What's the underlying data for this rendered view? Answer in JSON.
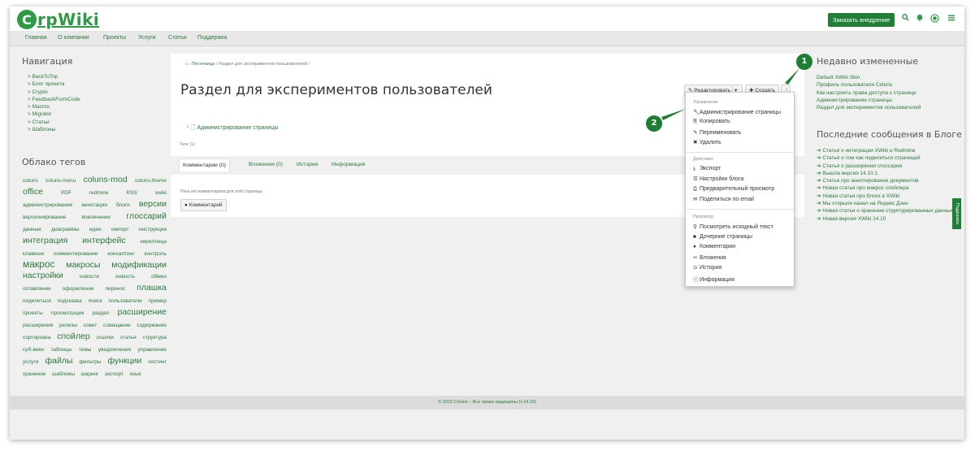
{
  "header": {
    "logo_mark": "C",
    "logo_text": "rpWiki",
    "order_button": "Заказать внедрение"
  },
  "mainnav": [
    "Главная",
    "О компании",
    "Проекты",
    "Услуги",
    "Статьи",
    "Поддержка"
  ],
  "left": {
    "nav_title": "Навигация",
    "nav_items": [
      "> BackToTop",
      "> Блог проекта",
      "> Crypto",
      "> FeedbackFormCode",
      "> Macros",
      "> Migrator",
      "> Статьи",
      "> Шаблоны"
    ],
    "tags_title": "Облако тегов",
    "tags": [
      {
        "t": "coluns",
        "s": 1
      },
      {
        "t": "coluns-menu",
        "s": 1
      },
      {
        "t": "coluns-mod",
        "s": 3
      },
      {
        "t": "coluns-theme",
        "s": 1
      },
      {
        "t": "office",
        "s": 3
      },
      {
        "t": "PDF",
        "s": 1
      },
      {
        "t": "redmine",
        "s": 1
      },
      {
        "t": "RSS",
        "s": 1
      },
      {
        "t": "xwiki",
        "s": 1
      },
      {
        "t": "администрирование",
        "s": 1
      },
      {
        "t": "аннотации",
        "s": 1
      },
      {
        "t": "блоги",
        "s": 1
      },
      {
        "t": "версии",
        "s": 3
      },
      {
        "t": "версионирование",
        "s": 1
      },
      {
        "t": "вовлечение",
        "s": 1
      },
      {
        "t": "глоссарий",
        "s": 3
      },
      {
        "t": "данные",
        "s": 1
      },
      {
        "t": "диаграммы",
        "s": 1
      },
      {
        "t": "идеи",
        "s": 1
      },
      {
        "t": "импорт",
        "s": 1
      },
      {
        "t": "инструкция",
        "s": 1
      },
      {
        "t": "интеграция",
        "s": 3
      },
      {
        "t": "интерфейс",
        "s": 3
      },
      {
        "t": "кириллица",
        "s": 1
      },
      {
        "t": "клавиши",
        "s": 1
      },
      {
        "t": "комментирование",
        "s": 1
      },
      {
        "t": "консалтинг",
        "s": 1
      },
      {
        "t": "контроль",
        "s": 1
      },
      {
        "t": "макрос",
        "s": 4
      },
      {
        "t": "макросы",
        "s": 3
      },
      {
        "t": "модификации",
        "s": 3
      },
      {
        "t": "настройки",
        "s": 3
      },
      {
        "t": "новости",
        "s": 1
      },
      {
        "t": "новость",
        "s": 1
      },
      {
        "t": "обмен",
        "s": 1
      },
      {
        "t": "оглавление",
        "s": 1
      },
      {
        "t": "оформление",
        "s": 1
      },
      {
        "t": "перенос",
        "s": 1
      },
      {
        "t": "плашка",
        "s": 3
      },
      {
        "t": "поделиться",
        "s": 1
      },
      {
        "t": "подсказка",
        "s": 1
      },
      {
        "t": "поиск",
        "s": 1
      },
      {
        "t": "пользователи",
        "s": 1
      },
      {
        "t": "пример",
        "s": 1
      },
      {
        "t": "проекты",
        "s": 1
      },
      {
        "t": "просмотрщик",
        "s": 1
      },
      {
        "t": "раздел",
        "s": 1
      },
      {
        "t": "расширение",
        "s": 3
      },
      {
        "t": "расширения",
        "s": 1
      },
      {
        "t": "релизы",
        "s": 1
      },
      {
        "t": "совет",
        "s": 1
      },
      {
        "t": "совещание",
        "s": 1
      },
      {
        "t": "содержание",
        "s": 1
      },
      {
        "t": "сортировка",
        "s": 1
      },
      {
        "t": "спойлер",
        "s": 3
      },
      {
        "t": "ссылки",
        "s": 1
      },
      {
        "t": "статья",
        "s": 1
      },
      {
        "t": "структура",
        "s": 1
      },
      {
        "t": "суб-вики",
        "s": 1
      },
      {
        "t": "таблицы",
        "s": 1
      },
      {
        "t": "темы",
        "s": 1
      },
      {
        "t": "уведомления",
        "s": 1
      },
      {
        "t": "управление",
        "s": 1
      },
      {
        "t": "услуги",
        "s": 1
      },
      {
        "t": "файлы",
        "s": 3
      },
      {
        "t": "фильтры",
        "s": 1
      },
      {
        "t": "функции",
        "s": 3
      },
      {
        "t": "хостинг",
        "s": 1
      },
      {
        "t": "хранение",
        "s": 1
      },
      {
        "t": "шаблоны",
        "s": 1
      },
      {
        "t": "шаринг",
        "s": 1
      },
      {
        "t": "экспорт",
        "s": 1
      },
      {
        "t": "язык",
        "s": 1
      }
    ]
  },
  "content": {
    "breadcrumb_home": "⌂ ›",
    "breadcrumb_1": "Песочница ›",
    "breadcrumb_2": "Раздел для экспериментов пользователей ›",
    "title": "Раздел для экспериментов пользователей",
    "edit_button": "✎ Редактировать",
    "edit_caret": "▾",
    "create_button": "✚ Создать",
    "more_button": "⋮",
    "child_page": "Администрирование страницы",
    "tags_label": "Теги: [+]"
  },
  "tabs": [
    {
      "label": "Комментарии (0)",
      "active": true
    },
    {
      "label": "Вложения (0)",
      "active": false
    },
    {
      "label": "История",
      "active": false
    },
    {
      "label": "Информация",
      "active": false
    }
  ],
  "tab_body": {
    "empty": "Пока нет комментариев для этой страницы",
    "comment_button": "Комментарий"
  },
  "menu": {
    "h_manage": "Управление",
    "manage": [
      {
        "icon": "wrench-icon",
        "glyph": "🔧",
        "label": "Администрирование страницы"
      },
      {
        "icon": "copy-icon",
        "glyph": "⎘",
        "label": "Копировать"
      },
      {
        "icon": "rename-icon",
        "glyph": "✎",
        "label": "Переименовать"
      },
      {
        "icon": "delete-icon",
        "glyph": "✖",
        "label": "Удалить"
      }
    ],
    "h_actions": "Действия",
    "actions": [
      {
        "icon": "export-icon",
        "glyph": "⤓",
        "label": "Экспорт"
      },
      {
        "icon": "rss-icon",
        "glyph": "☰",
        "label": "Настройки блога"
      },
      {
        "icon": "print-icon",
        "glyph": "⎙",
        "label": "Предварительный просмотр"
      },
      {
        "icon": "email-icon",
        "glyph": "✉",
        "label": "Поделиться по email"
      }
    ],
    "h_view": "Просмотр",
    "view": [
      {
        "icon": "search-icon",
        "glyph": "⚲",
        "label": "Посмотреть исходный текст"
      },
      {
        "icon": "folder-icon",
        "glyph": "■",
        "label": "Дочерние страницы"
      },
      {
        "icon": "comment-icon",
        "glyph": "●",
        "label": "Комментарии"
      },
      {
        "icon": "attachment-icon",
        "glyph": "✂",
        "label": "Вложения"
      },
      {
        "icon": "history-icon",
        "glyph": "⊙",
        "label": "История"
      },
      {
        "icon": "info-icon",
        "glyph": "ⓘ",
        "label": "Информация"
      }
    ]
  },
  "right": {
    "recent_title": "Недавно измененные",
    "recent": [
      "Default XWiki Skin",
      "Профиль пользователя Coluns",
      "Как настроить права доступа к странице",
      "Администрирование страницы",
      "Раздел для экспериментов пользователей"
    ],
    "blog_title": "Последние сообщения в Блоге",
    "blog": [
      "Статья о интеграции XWiki и Redmine",
      "Статья о том как поделиться страницей",
      "Статья о расширении глоссария",
      "Вышла версия 14.10.1",
      "Статья про аннотирование документов",
      "Новая статья про макрос спойлера",
      "Новая статья про блоги в XWiki",
      "Мы открыли канал на Яндекс Дзен",
      "Новая статья о хранении структурированных данных",
      "Новая версия XWiki 14.10"
    ]
  },
  "side_tab": "Поддержка",
  "footer": "© 2023 Coluns – Все права защищены (v.14.10)",
  "badges": [
    "1",
    "2"
  ],
  "colors": {
    "brand": "#2e9a44",
    "dark_green": "#1f7f35"
  }
}
